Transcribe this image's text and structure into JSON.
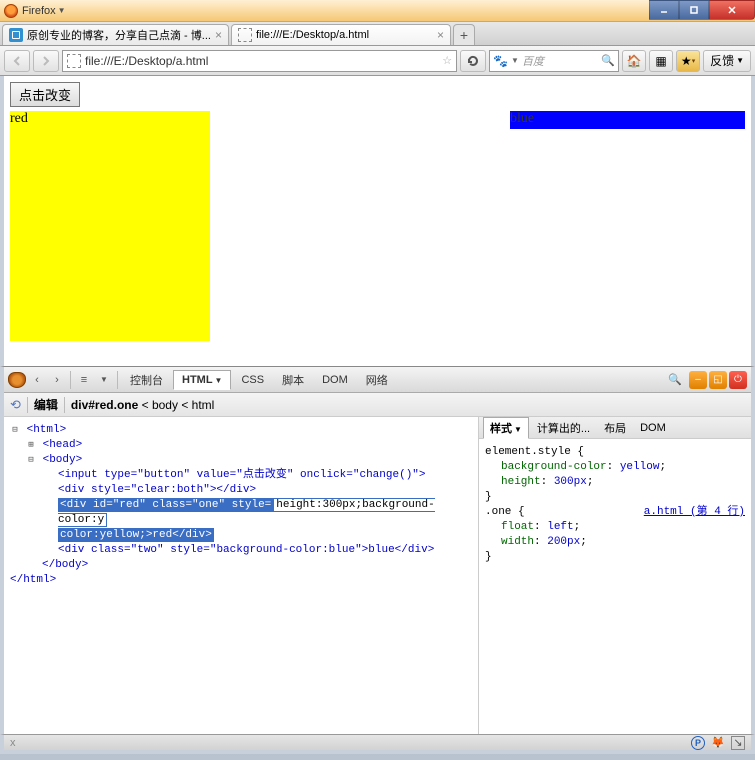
{
  "app": {
    "name": "Firefox"
  },
  "tabs": [
    {
      "title": "原创专业的博客，分享自己点滴 - 博..."
    },
    {
      "title": "file:///E:/Desktop/a.html"
    }
  ],
  "newtab": "+",
  "url": "file:///E:/Desktop/a.html",
  "search": {
    "placeholder": "百度"
  },
  "feedback": "反馈",
  "page": {
    "button_label": "点击改变",
    "red_text": "red",
    "blue_text": "blue"
  },
  "devtools": {
    "tabs": {
      "console": "控制台",
      "html": "HTML",
      "css": "CSS",
      "script": "脚本",
      "dom": "DOM",
      "net": "网络"
    },
    "breadcrumb": {
      "edit": "编辑",
      "path_sel": "div#red.one",
      "path_rest": " < body < html"
    },
    "html_tree": {
      "l1": "<html>",
      "l2": "<head>",
      "l3": "<body>",
      "l4_a": "<input type=\"",
      "l4_b": "button",
      "l4_c": "\" value=\"",
      "l4_d": "点击改变",
      "l4_e": "\" onclick=\"",
      "l4_f": "change()",
      "l4_g": "\">",
      "l5_a": "<div style=\"",
      "l5_b": "clear:both",
      "l5_c": "\"></div>",
      "l6_a": "<div id=\"",
      "l6_b": "red",
      "l6_c": "\" class=\"",
      "l6_d": "one",
      "l6_e": "\" style=",
      "l6_edit": "height:300px;background-color:y",
      "l6_f": "color:yellow;",
      "l6_g": ">red</div>",
      "l7_a": "<div class=\"",
      "l7_b": "two",
      "l7_c": "\" style=\"",
      "l7_d": "background-color:blue",
      "l7_e": "\">blue</div>",
      "l8": "</body>",
      "l9": "</html>"
    },
    "css_tabs": {
      "styles": "样式",
      "computed": "计算出的...",
      "layout": "布局",
      "dom": "DOM"
    },
    "css_panel": {
      "r1": "element.style {",
      "r2_p": "background-color",
      "r2_v": "yellow",
      "r3_p": "height",
      "r3_v": "300px",
      "r4": "}",
      "r5": ".one {",
      "r5_link": "a.html (第 4 行)",
      "r6_p": "float",
      "r6_v": "left",
      "r7_p": "width",
      "r7_v": "200px",
      "r8": "}"
    }
  },
  "status": {
    "x": "x"
  }
}
